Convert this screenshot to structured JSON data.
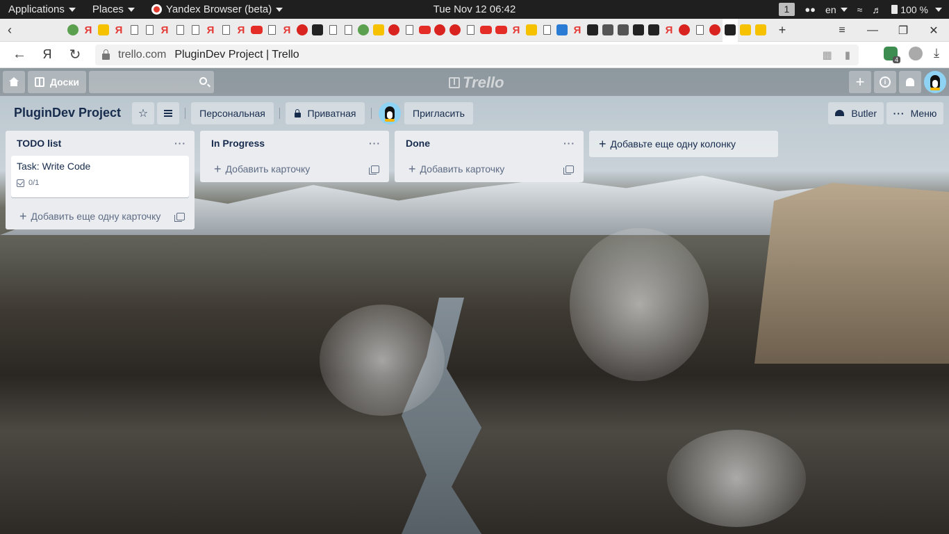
{
  "system_bar": {
    "applications": "Applications",
    "places": "Places",
    "browser_app": "Yandex Browser (beta)",
    "clock": "Tue Nov 12  06:42",
    "workspace": "1",
    "language": "en",
    "battery": "100 %"
  },
  "browser": {
    "omnibox_domain": "trello.com",
    "omnibox_title": "PluginDev Project | Trello",
    "extension_badge": "4",
    "tab_favicons": [
      "trello",
      "trello",
      "trello",
      "green",
      "ya",
      "stack",
      "ya",
      "doc",
      "doc",
      "ya",
      "doc",
      "doc",
      "ya",
      "doc",
      "ya",
      "yt",
      "doc",
      "ya",
      "check",
      "w",
      "doc",
      "doc",
      "green",
      "yellow",
      "red",
      "doc",
      "yt",
      "red",
      "red",
      "doc",
      "yt",
      "yt",
      "ya",
      "film",
      "doc",
      "vscode",
      "ya",
      "dark",
      "gog",
      "gog",
      "github",
      "github",
      "ya",
      "git",
      "doc",
      "red",
      "active",
      "burger",
      "burger"
    ]
  },
  "trello": {
    "header": {
      "boards_label": "Доски",
      "logo_text": "Trello"
    },
    "board": {
      "title": "PluginDev Project",
      "team_label": "Персональная",
      "visibility_label": "Приватная",
      "invite_label": "Пригласить",
      "butler_label": "Butler",
      "menu_label": "Меню"
    },
    "lists": [
      {
        "title": "TODO list",
        "cards": [
          {
            "title": "Task: Write Code",
            "checklist": "0/1"
          }
        ],
        "add_card_label": "Добавить еще одну карточку"
      },
      {
        "title": "In Progress",
        "cards": [],
        "add_card_label": "Добавить карточку"
      },
      {
        "title": "Done",
        "cards": [],
        "add_card_label": "Добавить карточку"
      }
    ],
    "add_list_label": "Добавьте еще одну колонку"
  },
  "colors": {
    "trello_text": "#172b4d",
    "list_bg": "#ebecf0",
    "secondary_text": "#5e6c84"
  }
}
